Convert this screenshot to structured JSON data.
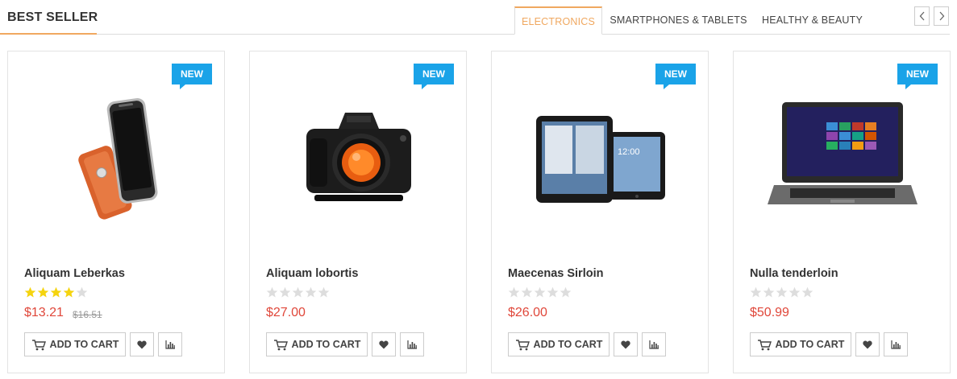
{
  "section": {
    "title": "BEST SELLER"
  },
  "tabs": [
    {
      "label": "ELECTRONICS",
      "active": true
    },
    {
      "label": "SMARTPHONES & TABLETS",
      "active": false
    },
    {
      "label": "HEALTHY & BEAUTY",
      "active": false
    }
  ],
  "nav": {
    "prev_icon": "chevron-left-icon",
    "next_icon": "chevron-right-icon"
  },
  "colors": {
    "accent": "#f0a860",
    "badge": "#1aa3e8",
    "price": "#e0473a",
    "star_filled": "#f5d40f",
    "star_empty": "#dddddd"
  },
  "products": [
    {
      "badge": "NEW",
      "name": "Aliquam Leberkas",
      "rating": 4,
      "rating_max": 5,
      "price": "$13.21",
      "old_price": "$16.51",
      "cart_label": "ADD TO CART",
      "image": "smartphone"
    },
    {
      "badge": "NEW",
      "name": "Aliquam lobortis",
      "rating": 0,
      "rating_max": 5,
      "price": "$27.00",
      "old_price": "",
      "cart_label": "ADD TO CART",
      "image": "camera"
    },
    {
      "badge": "NEW",
      "name": "Maecenas Sirloin",
      "rating": 0,
      "rating_max": 5,
      "price": "$26.00",
      "old_price": "",
      "cart_label": "ADD TO CART",
      "image": "tablets"
    },
    {
      "badge": "NEW",
      "name": "Nulla tenderloin",
      "rating": 0,
      "rating_max": 5,
      "price": "$50.99",
      "old_price": "",
      "cart_label": "ADD TO CART",
      "image": "laptop"
    }
  ]
}
